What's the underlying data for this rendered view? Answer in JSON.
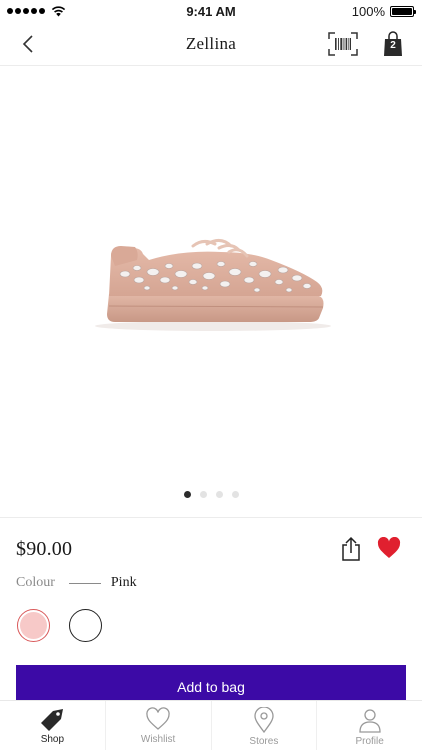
{
  "status_bar": {
    "time": "9:41 AM",
    "battery": "100%",
    "signal_icon": "cellular-signal-icon",
    "wifi_icon": "wifi-icon"
  },
  "nav": {
    "title": "Zellina",
    "back_icon": "chevron-left-icon",
    "barcode_icon": "barcode-scanner-icon",
    "bag_icon": "shopping-bag-icon",
    "bag_count": "2"
  },
  "product": {
    "image_icon": "sneaker-product-image",
    "pager": {
      "total": 4,
      "active": 0
    },
    "price": "$90.00",
    "colour_label": "Colour",
    "colour_value": "Pink",
    "swatches": [
      {
        "name": "pink",
        "color": "#f7c9c8",
        "selected": true
      },
      {
        "name": "white",
        "color": "#ffffff",
        "selected": false
      }
    ],
    "favorite": true
  },
  "actions": {
    "add_to_bag": "Add to bag"
  },
  "tabs": [
    {
      "label": "Shop",
      "icon": "tag-icon",
      "active": true
    },
    {
      "label": "Wishlist",
      "icon": "heart-icon",
      "active": false
    },
    {
      "label": "Stores",
      "icon": "location-pin-icon",
      "active": false
    },
    {
      "label": "Profile",
      "icon": "person-icon",
      "active": false
    }
  ],
  "colors": {
    "accent": "#3c0aa6",
    "favorite": "#e0202f",
    "swatch_ring": "#d9595a"
  }
}
